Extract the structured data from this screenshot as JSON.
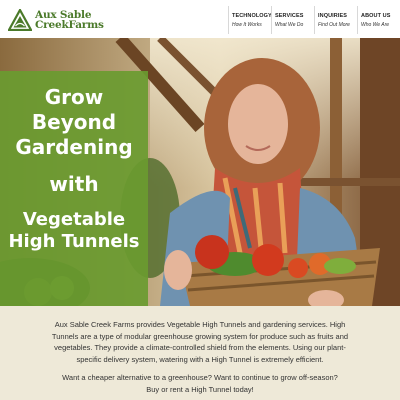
{
  "brand": {
    "line1": "Aux Sable",
    "line2": "CreekFarms"
  },
  "nav": [
    {
      "title": "TECHNOLOGY",
      "sub": "How It Works"
    },
    {
      "title": "SERVICES",
      "sub": "What We Do"
    },
    {
      "title": "INQUIRIES",
      "sub": "Find Out More"
    },
    {
      "title": "ABOUT US",
      "sub": "Who We Are"
    }
  ],
  "hero": {
    "line1": "Grow",
    "line2": "Beyond",
    "line3": "Gardening",
    "line_with": "with",
    "line4": "Vegetable",
    "line5": "High Tunnels"
  },
  "content": {
    "paragraph1": "Aux Sable Creek Farms provides Vegetable High Tunnels and gardening services. High Tunnels are a type of modular greenhouse growing system for produce such as fruits and vegetables. They provide a climate-controlled shield from the elements. Using our plant-specific delivery system, watering with a High Tunnel is extremely efficient.",
    "paragraph2": "Want a cheaper alternative to a greenhouse? Want to continue to grow off-season? Buy or rent a High Tunnel today!"
  },
  "colors": {
    "brand_green": "#4b7a2a",
    "hero_box": "#6a9b30",
    "content_bg": "#eee9d8"
  }
}
